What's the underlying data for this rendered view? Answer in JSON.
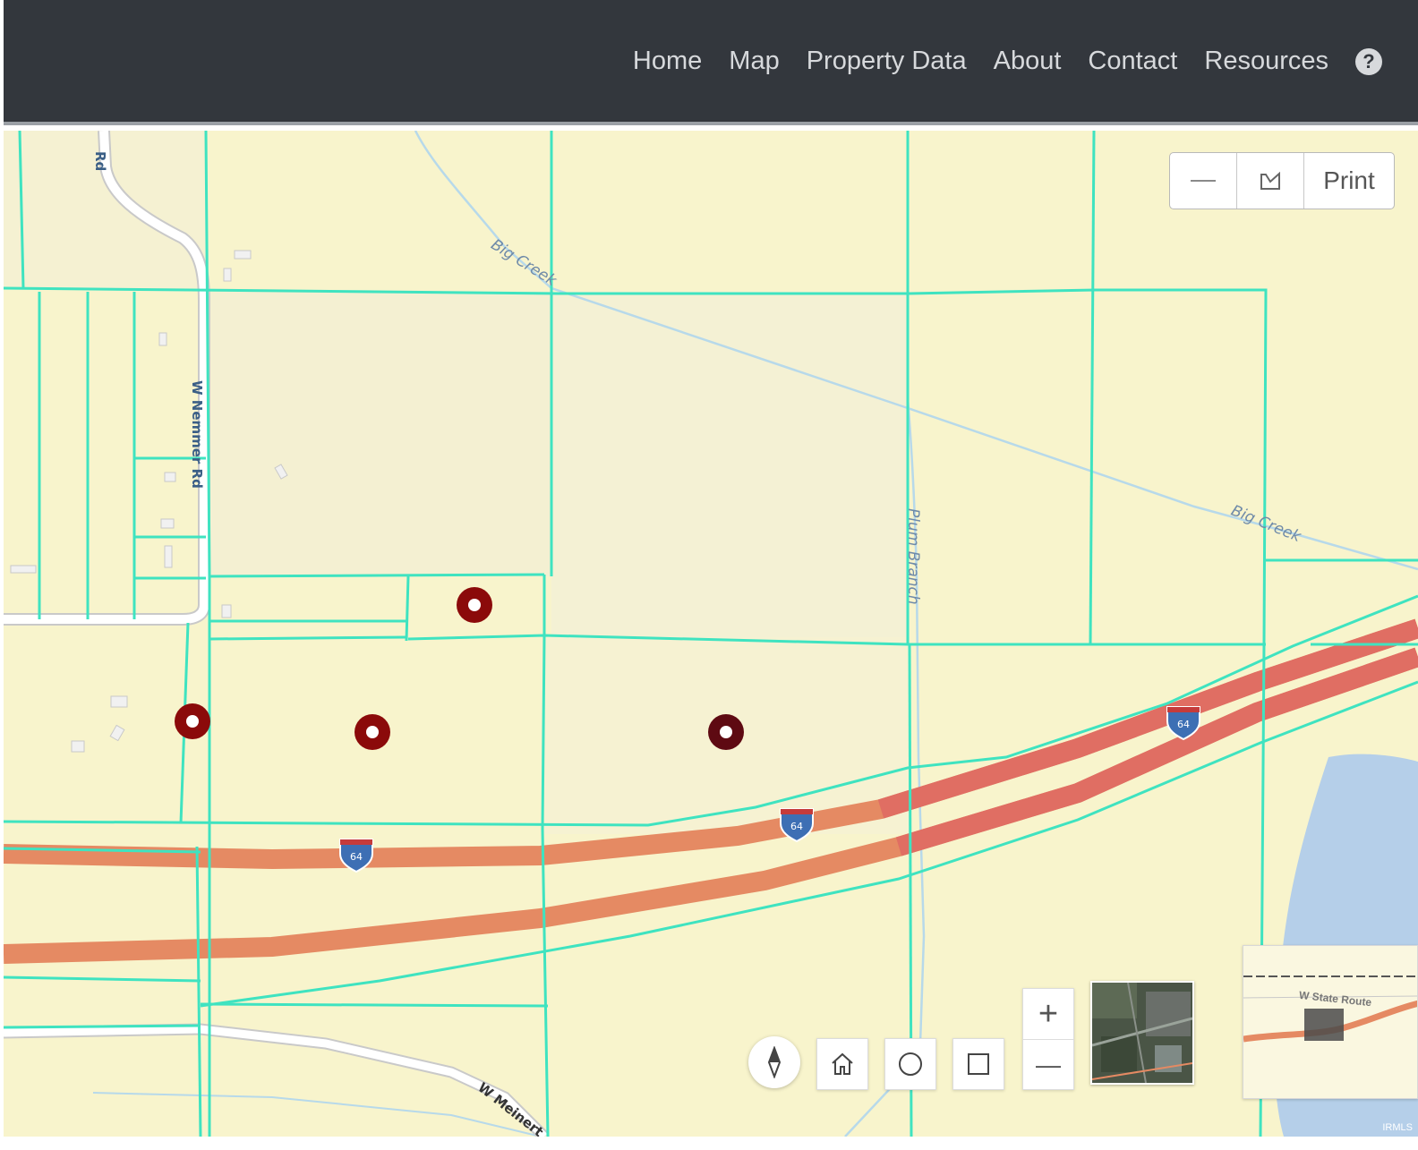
{
  "nav": {
    "items": [
      {
        "label": "Home"
      },
      {
        "label": "Map"
      },
      {
        "label": "Property Data"
      },
      {
        "label": "About"
      },
      {
        "label": "Contact"
      },
      {
        "label": "Resources"
      }
    ],
    "help_icon": "question-circle-icon",
    "help_glyph": "?"
  },
  "map": {
    "labels": {
      "rd_top": "Rd",
      "nemmer_rd": "W Nemmer Rd",
      "big_creek_1": "Big Creek",
      "big_creek_2": "Big Creek",
      "plum_branch": "Plum Branch",
      "w_meinert": "W Meinert"
    },
    "shields": [
      {
        "number": "64"
      },
      {
        "number": "64"
      },
      {
        "number": "64"
      }
    ],
    "markers_count_shown": 4,
    "colors": {
      "parcel_lines": "#3fe3c0",
      "background": "#f8f4cc",
      "highway": "#e58a63",
      "marker": "#8b0a0a",
      "water": "#b5cfe9"
    }
  },
  "toolbar": {
    "collapse_icon": "minus-icon",
    "select_icon": "select-shape-icon",
    "print_label": "Print"
  },
  "controls": {
    "compass_icon": "compass-icon",
    "home_icon": "home-icon",
    "circle_icon": "circle-select-icon",
    "square_icon": "square-select-icon",
    "zoom_in_glyph": "+",
    "zoom_out_glyph": "—"
  },
  "overview": {
    "road_label": "W State Route"
  },
  "attribution": "IRMLS"
}
